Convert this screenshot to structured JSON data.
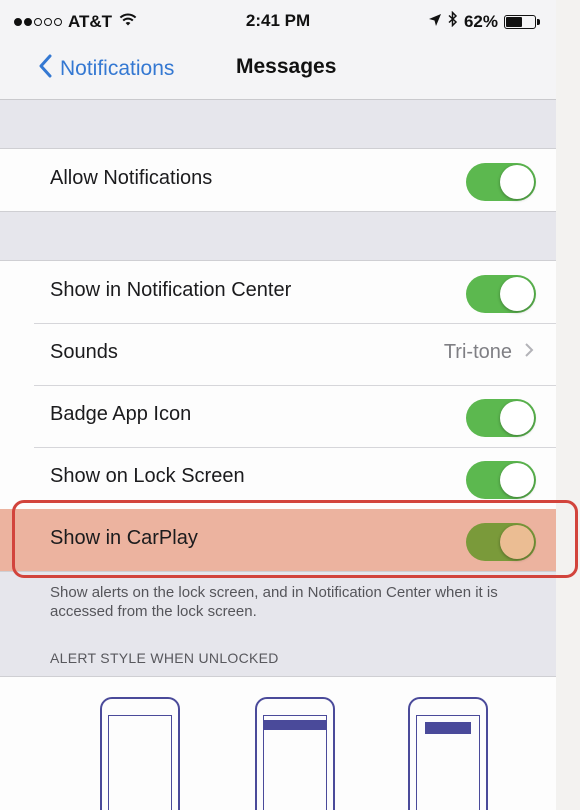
{
  "status_bar": {
    "carrier": "AT&T",
    "time": "2:41 PM",
    "battery_percent": "62%",
    "battery_level": 0.62,
    "icons": [
      "signal-dots-icon",
      "wifi-icon",
      "location-arrow-icon",
      "bluetooth-icon",
      "battery-icon"
    ]
  },
  "nav": {
    "back_label": "Notifications",
    "title": "Messages"
  },
  "group1": {
    "allow_notifications": {
      "label": "Allow Notifications",
      "on": true
    }
  },
  "group2": {
    "items": [
      {
        "label": "Show in Notification Center",
        "control": "toggle",
        "on": true
      },
      {
        "label": "Sounds",
        "control": "disclosure",
        "value": "Tri-tone"
      },
      {
        "label": "Badge App Icon",
        "control": "toggle",
        "on": true
      },
      {
        "label": "Show on Lock Screen",
        "control": "toggle",
        "on": true
      },
      {
        "label": "Show in CarPlay",
        "control": "toggle",
        "on": true,
        "highlighted": true
      }
    ]
  },
  "footer_note": "Show alerts on the lock screen, and in Notification Center when it is accessed from the lock screen.",
  "alert_style": {
    "header": "ALERT STYLE WHEN UNLOCKED",
    "options": [
      "none",
      "banners",
      "alerts"
    ]
  },
  "colors": {
    "accent": "#3478d2",
    "toggle_on": "#5cb84f",
    "highlight_fill": "#ecb39f",
    "highlight_border": "#d2443c",
    "phone_outline": "#4a4a9a"
  }
}
